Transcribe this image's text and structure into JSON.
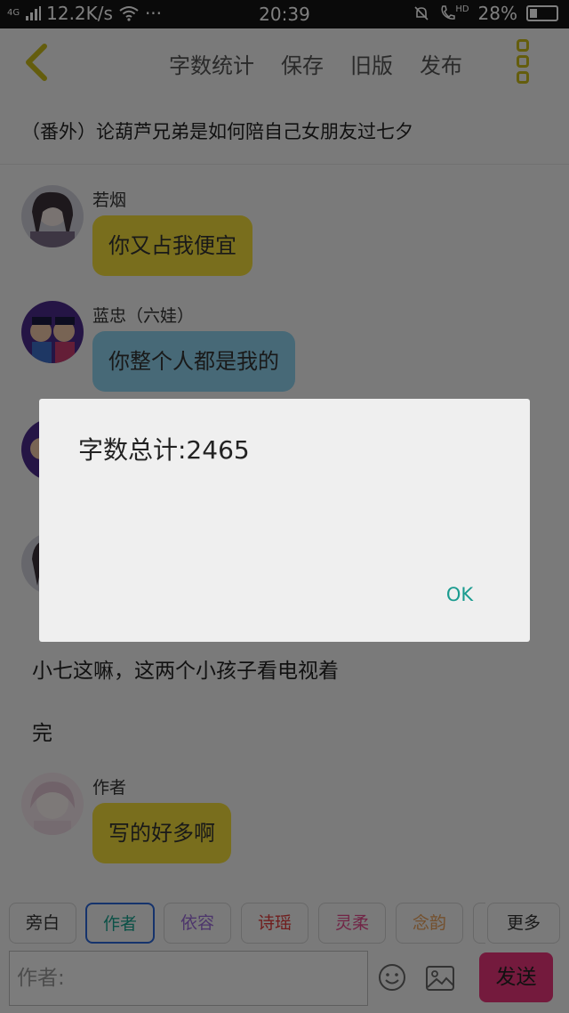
{
  "status_bar": {
    "network_type": "4G",
    "speed": "12.2K/s",
    "more": "···",
    "time": "20:39",
    "call_quality": "HD",
    "battery_percent": "28%",
    "battery_level": 0.28
  },
  "header": {
    "back_icon": "chevron-left-icon",
    "actions": [
      "字数统计",
      "保存",
      "旧版",
      "发布"
    ],
    "menu_icon": "more-vertical-icon",
    "accent_color": "#c9bb1a"
  },
  "document": {
    "title": "（番外）论葫芦兄弟是如何陪自己女朋友过七夕"
  },
  "messages": [
    {
      "speaker": "若烟",
      "text": "你又占我便宜",
      "bubble_color": "#f2dd3a"
    },
    {
      "speaker": "蓝忠（六娃）",
      "text": "你整个人都是我的",
      "bubble_color": "#8fd3ee"
    },
    {
      "speaker": "作者",
      "text": "写的好多啊",
      "bubble_color": "#f2dd3a"
    }
  ],
  "narrations": [
    "小七这嘛，这两个小孩子看电视着",
    "完"
  ],
  "role_bar": {
    "roles": [
      {
        "label": "旁白",
        "color": "#333333"
      },
      {
        "label": "作者",
        "color": "#19a38f"
      },
      {
        "label": "依容",
        "color": "#9b6bd8"
      },
      {
        "label": "诗瑶",
        "color": "#e03a3a"
      },
      {
        "label": "灵柔",
        "color": "#e24a8d"
      },
      {
        "label": "念韵",
        "color": "#e8a05a"
      },
      {
        "label": "",
        "color": "#333333"
      }
    ],
    "more_label": "更多",
    "selected": "作者"
  },
  "input_bar": {
    "placeholder": "作者:",
    "emoji_icon": "smiley-icon",
    "image_icon": "image-icon",
    "send_label": "发送",
    "send_color": "#e8347a"
  },
  "dialog": {
    "message": "字数总计:2465",
    "ok_label": "OK"
  }
}
